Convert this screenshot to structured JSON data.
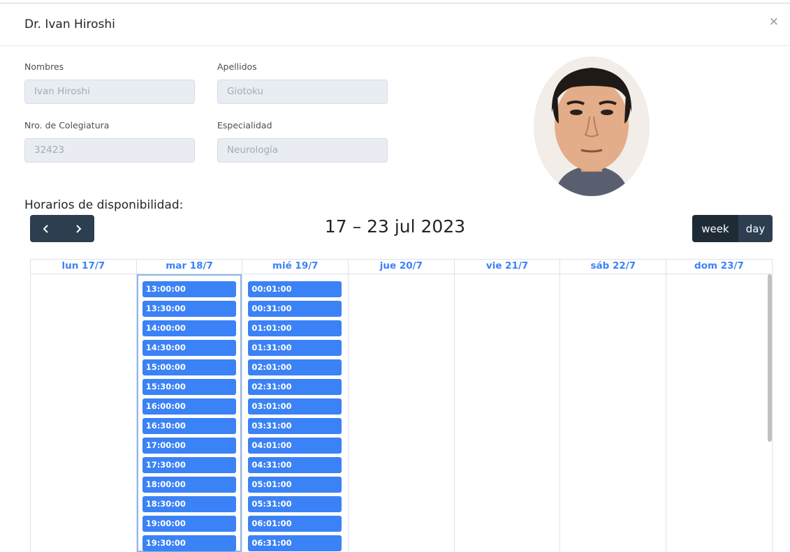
{
  "modal": {
    "title": "Dr. Ivan Hiroshi",
    "close_label": "×"
  },
  "form": {
    "nombres_label": "Nombres",
    "nombres_value": "Ivan Hiroshi",
    "apellidos_label": "Apellidos",
    "apellidos_value": "Giotoku",
    "colegiatura_label": "Nro. de Colegiatura",
    "colegiatura_value": "32423",
    "especialidad_label": "Especialidad",
    "especialidad_value": "Neurología"
  },
  "section_title": "Horarios de disponibilidad:",
  "calendar": {
    "nav": {
      "prev_icon": "chevron-left-icon",
      "next_icon": "chevron-right-icon"
    },
    "range_title": "17 – 23 jul 2023",
    "views": {
      "week": "week",
      "day": "day",
      "active": "week"
    },
    "days": [
      "lun 17/7",
      "mar 18/7",
      "mié 19/7",
      "jue 20/7",
      "vie 21/7",
      "sáb 22/7",
      "dom 23/7"
    ],
    "slots": {
      "mar": [
        "13:00:00",
        "13:30:00",
        "14:00:00",
        "14:30:00",
        "15:00:00",
        "15:30:00",
        "16:00:00",
        "16:30:00",
        "17:00:00",
        "17:30:00",
        "18:00:00",
        "18:30:00",
        "19:00:00",
        "19:30:00"
      ],
      "mie": [
        "00:01:00",
        "00:31:00",
        "01:01:00",
        "01:31:00",
        "02:01:00",
        "02:31:00",
        "03:01:00",
        "03:31:00",
        "04:01:00",
        "04:31:00",
        "05:01:00",
        "05:31:00",
        "06:01:00",
        "06:31:00"
      ]
    }
  },
  "colors": {
    "accent": "#3b82f6",
    "nav_dark": "#2c3e50",
    "input_bg": "#e9edf3"
  }
}
